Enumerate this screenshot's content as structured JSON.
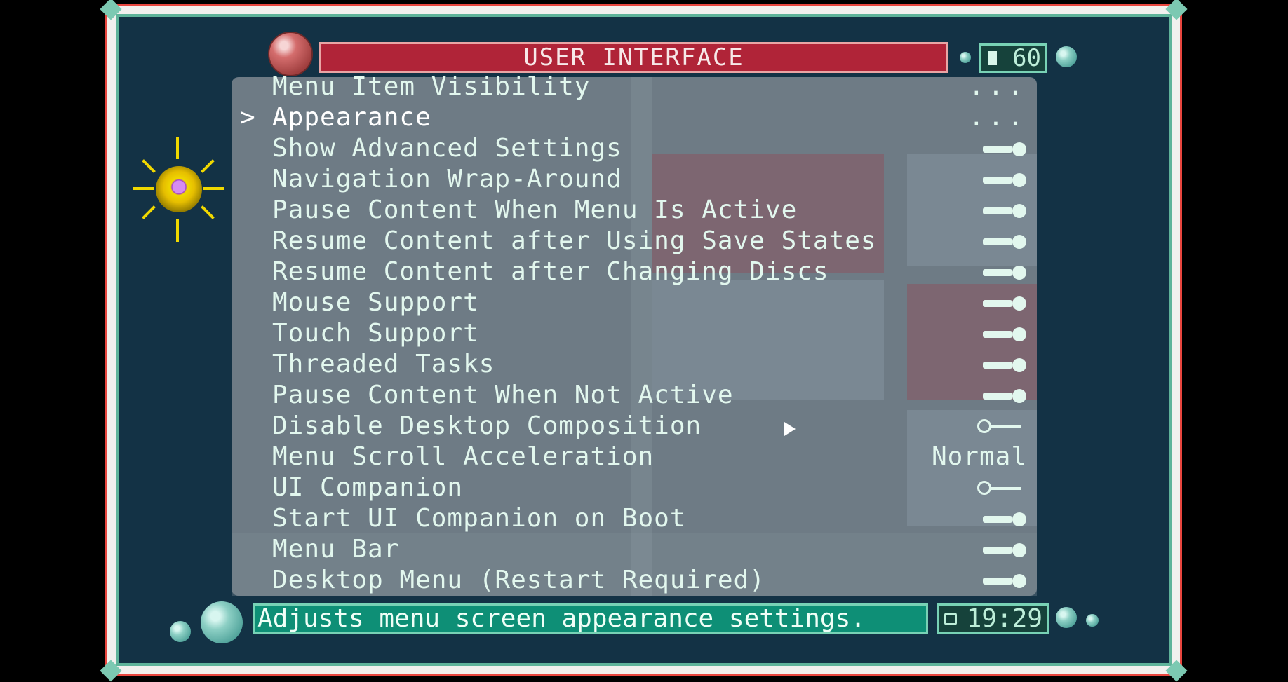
{
  "header": {
    "title": "USER INTERFACE",
    "battery_value": "60"
  },
  "menu": {
    "items": [
      {
        "label": "Menu Item Visibility",
        "value": "...",
        "type": "submenu"
      },
      {
        "label": "Appearance",
        "value": "...",
        "type": "submenu",
        "selected": true
      },
      {
        "label": "Show Advanced Settings",
        "type": "toggle",
        "state": "on"
      },
      {
        "label": "Navigation Wrap-Around",
        "type": "toggle",
        "state": "on"
      },
      {
        "label": "Pause Content When Menu Is Active",
        "type": "toggle",
        "state": "on"
      },
      {
        "label": "Resume Content after Using Save States",
        "type": "toggle",
        "state": "on"
      },
      {
        "label": "Resume Content after Changing Discs",
        "type": "toggle",
        "state": "on"
      },
      {
        "label": "Mouse Support",
        "type": "toggle",
        "state": "on"
      },
      {
        "label": "Touch Support",
        "type": "toggle",
        "state": "on"
      },
      {
        "label": "Threaded Tasks",
        "type": "toggle",
        "state": "on"
      },
      {
        "label": "Pause Content When Not Active",
        "type": "toggle",
        "state": "on"
      },
      {
        "label": "Disable Desktop Composition",
        "type": "toggle",
        "state": "off"
      },
      {
        "label": "Menu Scroll Acceleration",
        "value": "Normal",
        "type": "text"
      },
      {
        "label": "UI Companion",
        "type": "toggle",
        "state": "off"
      },
      {
        "label": "Start UI Companion on Boot",
        "type": "toggle",
        "state": "on"
      },
      {
        "label": "Menu Bar",
        "type": "toggle",
        "state": "on"
      },
      {
        "label": "Desktop Menu (Restart Required)",
        "type": "toggle",
        "state": "on"
      }
    ]
  },
  "footer": {
    "description": "Adjusts menu screen appearance settings.",
    "clock": "19:29"
  },
  "colors": {
    "title_bg": "#b02438",
    "status_bg": "#0e8f76",
    "panel_bg": "#738089",
    "frame_bg": "#133245"
  },
  "icons": {
    "title_orb": "red-orb-icon",
    "battery": "battery-icon",
    "clock": "clock-icon",
    "logo": "sun-moon-icon"
  }
}
